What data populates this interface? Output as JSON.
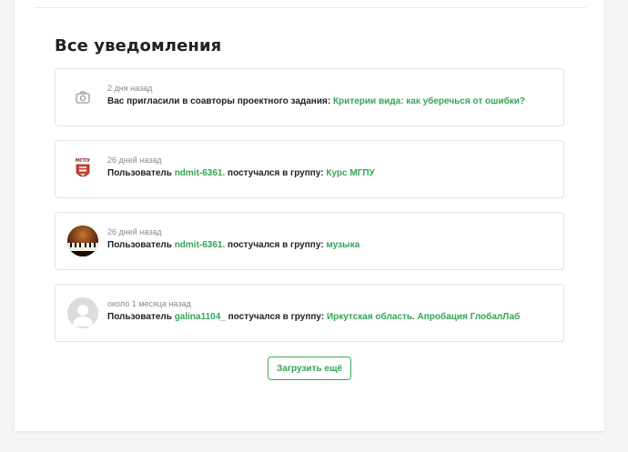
{
  "page": {
    "title": "Все уведомления",
    "load_more_label": "Загрузить ещё"
  },
  "notifications": [
    {
      "time": "2 дня назад",
      "text1": "Вас пригласили в соавторы проектного задания: ",
      "link1": "Критерии вида: как уберечься от ошибки?",
      "avatar": "camera-icon"
    },
    {
      "time": "26 дней назад",
      "text1": "Пользователь ",
      "link1": "ndmit-6361.",
      "text2": " постучался в группу: ",
      "link2": "Курс МГПУ",
      "avatar": "university-logo",
      "avatar_label": "МГПУ"
    },
    {
      "time": "26 дней назад",
      "text1": "Пользователь ",
      "link1": "ndmit-6361.",
      "text2": " постучался в группу: ",
      "link2": "музыка",
      "avatar": "piano-photo"
    },
    {
      "time": "около 1 месяца назад",
      "text1": "Пользователь ",
      "link1": "galina1104_",
      "text2": " постучался в группу: ",
      "link2": "Иркутская область. Апробация ГлобалЛаб",
      "avatar": "default-user-avatar"
    }
  ],
  "colors": {
    "link": "#33a557",
    "border": "#e3e3e3",
    "background": "#f4f5f6"
  }
}
